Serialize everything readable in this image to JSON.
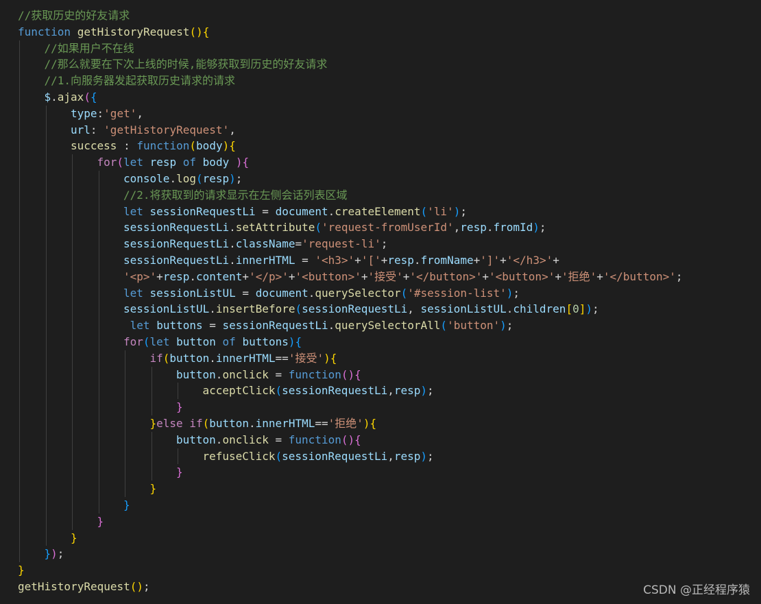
{
  "colors": {
    "background": "#1e1e1e",
    "comment": "#6a9955",
    "keyword": "#569cd6",
    "control": "#c586c0",
    "function": "#dcdcaa",
    "variable": "#9cdcfe",
    "string": "#ce9178",
    "number": "#b5cea8",
    "text": "#d4d4d4",
    "bracket1": "#ffd700",
    "bracket2": "#da70d6",
    "bracket3": "#179fff"
  },
  "editor": {
    "lines": [
      {
        "indent": 0,
        "tokens": [
          [
            "comment",
            "//获取历史的好友请求"
          ]
        ]
      },
      {
        "indent": 0,
        "tokens": [
          [
            "keyword",
            "function"
          ],
          [
            "text",
            " "
          ],
          [
            "function",
            "getHistoryRequest"
          ],
          [
            "bracket1",
            "(){"
          ]
        ]
      },
      {
        "indent": 1,
        "tokens": [
          [
            "comment",
            "//如果用户不在线"
          ]
        ]
      },
      {
        "indent": 1,
        "tokens": [
          [
            "comment",
            "//那么就要在下次上线的时候,能够获取到历史的好友请求"
          ]
        ]
      },
      {
        "indent": 1,
        "tokens": [
          [
            "comment",
            "//1.向服务器发起获取历史请求的请求"
          ]
        ]
      },
      {
        "indent": 1,
        "tokens": [
          [
            "variable",
            "$"
          ],
          [
            "text",
            "."
          ],
          [
            "function",
            "ajax"
          ],
          [
            "bracket2",
            "("
          ],
          [
            "bracket3",
            "{"
          ]
        ]
      },
      {
        "indent": 2,
        "tokens": [
          [
            "variable",
            "type"
          ],
          [
            "text",
            ":"
          ],
          [
            "string",
            "'get'"
          ],
          [
            "text",
            ","
          ]
        ]
      },
      {
        "indent": 2,
        "tokens": [
          [
            "variable",
            "url"
          ],
          [
            "text",
            ": "
          ],
          [
            "string",
            "'getHistoryRequest'"
          ],
          [
            "text",
            ","
          ]
        ]
      },
      {
        "indent": 2,
        "tokens": [
          [
            "function",
            "success"
          ],
          [
            "text",
            " : "
          ],
          [
            "keyword",
            "function"
          ],
          [
            "bracket1",
            "("
          ],
          [
            "variable",
            "body"
          ],
          [
            "bracket1",
            "){"
          ]
        ]
      },
      {
        "indent": 3,
        "tokens": [
          [
            "control",
            "for"
          ],
          [
            "bracket2",
            "("
          ],
          [
            "keyword",
            "let"
          ],
          [
            "text",
            " "
          ],
          [
            "variable",
            "resp"
          ],
          [
            "text",
            " "
          ],
          [
            "keyword",
            "of"
          ],
          [
            "text",
            " "
          ],
          [
            "variable",
            "body"
          ],
          [
            "text",
            " "
          ],
          [
            "bracket2",
            ")"
          ],
          [
            "bracket2",
            "{"
          ]
        ]
      },
      {
        "indent": 4,
        "tokens": [
          [
            "variable",
            "console"
          ],
          [
            "text",
            "."
          ],
          [
            "function",
            "log"
          ],
          [
            "bracket3",
            "("
          ],
          [
            "variable",
            "resp"
          ],
          [
            "bracket3",
            ")"
          ],
          [
            "text",
            ";"
          ]
        ]
      },
      {
        "indent": 4,
        "tokens": [
          [
            "comment",
            "//2.将获取到的请求显示在左侧会话列表区域"
          ]
        ]
      },
      {
        "indent": 4,
        "tokens": [
          [
            "keyword",
            "let"
          ],
          [
            "text",
            " "
          ],
          [
            "variable",
            "sessionRequestLi"
          ],
          [
            "text",
            " = "
          ],
          [
            "variable",
            "document"
          ],
          [
            "text",
            "."
          ],
          [
            "function",
            "createElement"
          ],
          [
            "bracket3",
            "("
          ],
          [
            "string",
            "'li'"
          ],
          [
            "bracket3",
            ")"
          ],
          [
            "text",
            ";"
          ]
        ]
      },
      {
        "indent": 4,
        "tokens": [
          [
            "variable",
            "sessionRequestLi"
          ],
          [
            "text",
            "."
          ],
          [
            "function",
            "setAttribute"
          ],
          [
            "bracket3",
            "("
          ],
          [
            "string",
            "'request-fromUserId'"
          ],
          [
            "text",
            ","
          ],
          [
            "variable",
            "resp"
          ],
          [
            "text",
            "."
          ],
          [
            "variable",
            "fromId"
          ],
          [
            "bracket3",
            ")"
          ],
          [
            "text",
            ";"
          ]
        ]
      },
      {
        "indent": 4,
        "tokens": [
          [
            "variable",
            "sessionRequestLi"
          ],
          [
            "text",
            "."
          ],
          [
            "variable",
            "className"
          ],
          [
            "text",
            "="
          ],
          [
            "string",
            "'request-li'"
          ],
          [
            "text",
            ";"
          ]
        ]
      },
      {
        "indent": 4,
        "tokens": [
          [
            "variable",
            "sessionRequestLi"
          ],
          [
            "text",
            "."
          ],
          [
            "variable",
            "innerHTML"
          ],
          [
            "text",
            " = "
          ],
          [
            "string",
            "'<h3>'"
          ],
          [
            "text",
            "+"
          ],
          [
            "string",
            "'['"
          ],
          [
            "text",
            "+"
          ],
          [
            "variable",
            "resp"
          ],
          [
            "text",
            "."
          ],
          [
            "variable",
            "fromName"
          ],
          [
            "text",
            "+"
          ],
          [
            "string",
            "']'"
          ],
          [
            "text",
            "+"
          ],
          [
            "string",
            "'</h3>'"
          ],
          [
            "text",
            "+"
          ]
        ]
      },
      {
        "indent": 4,
        "tokens": [
          [
            "string",
            "'<p>'"
          ],
          [
            "text",
            "+"
          ],
          [
            "variable",
            "resp"
          ],
          [
            "text",
            "."
          ],
          [
            "variable",
            "content"
          ],
          [
            "text",
            "+"
          ],
          [
            "string",
            "'</p>'"
          ],
          [
            "text",
            "+"
          ],
          [
            "string",
            "'<button>'"
          ],
          [
            "text",
            "+"
          ],
          [
            "string",
            "'接受'"
          ],
          [
            "text",
            "+"
          ],
          [
            "string",
            "'</button>'"
          ],
          [
            "text",
            "+"
          ],
          [
            "string",
            "'<button>'"
          ],
          [
            "text",
            "+"
          ],
          [
            "string",
            "'拒绝'"
          ],
          [
            "text",
            "+"
          ],
          [
            "string",
            "'</button>'"
          ],
          [
            "text",
            ";"
          ]
        ]
      },
      {
        "indent": 4,
        "tokens": [
          [
            "keyword",
            "let"
          ],
          [
            "text",
            " "
          ],
          [
            "variable",
            "sessionListUL"
          ],
          [
            "text",
            " = "
          ],
          [
            "variable",
            "document"
          ],
          [
            "text",
            "."
          ],
          [
            "function",
            "querySelector"
          ],
          [
            "bracket3",
            "("
          ],
          [
            "string",
            "'#session-list'"
          ],
          [
            "bracket3",
            ")"
          ],
          [
            "text",
            ";"
          ]
        ]
      },
      {
        "indent": 4,
        "tokens": [
          [
            "variable",
            "sessionListUL"
          ],
          [
            "text",
            "."
          ],
          [
            "function",
            "insertBefore"
          ],
          [
            "bracket3",
            "("
          ],
          [
            "variable",
            "sessionRequestLi"
          ],
          [
            "text",
            ", "
          ],
          [
            "variable",
            "sessionListUL"
          ],
          [
            "text",
            "."
          ],
          [
            "variable",
            "children"
          ],
          [
            "bracket1",
            "["
          ],
          [
            "number",
            "0"
          ],
          [
            "bracket1",
            "]"
          ],
          [
            "bracket3",
            ")"
          ],
          [
            "text",
            ";"
          ]
        ]
      },
      {
        "indent": 4,
        "tokens": [
          [
            "text",
            " "
          ],
          [
            "keyword",
            "let"
          ],
          [
            "text",
            " "
          ],
          [
            "variable",
            "buttons"
          ],
          [
            "text",
            " = "
          ],
          [
            "variable",
            "sessionRequestLi"
          ],
          [
            "text",
            "."
          ],
          [
            "function",
            "querySelectorAll"
          ],
          [
            "bracket3",
            "("
          ],
          [
            "string",
            "'button'"
          ],
          [
            "bracket3",
            ")"
          ],
          [
            "text",
            ";"
          ]
        ]
      },
      {
        "indent": 4,
        "tokens": [
          [
            "control",
            "for"
          ],
          [
            "bracket3",
            "("
          ],
          [
            "keyword",
            "let"
          ],
          [
            "text",
            " "
          ],
          [
            "variable",
            "button"
          ],
          [
            "text",
            " "
          ],
          [
            "keyword",
            "of"
          ],
          [
            "text",
            " "
          ],
          [
            "variable",
            "buttons"
          ],
          [
            "bracket3",
            ")"
          ],
          [
            "bracket3",
            "{"
          ]
        ]
      },
      {
        "indent": 5,
        "tokens": [
          [
            "control",
            "if"
          ],
          [
            "bracket1",
            "("
          ],
          [
            "variable",
            "button"
          ],
          [
            "text",
            "."
          ],
          [
            "variable",
            "innerHTML"
          ],
          [
            "text",
            "=="
          ],
          [
            "string",
            "'接受'"
          ],
          [
            "bracket1",
            ")"
          ],
          [
            "bracket1",
            "{"
          ]
        ]
      },
      {
        "indent": 6,
        "tokens": [
          [
            "variable",
            "button"
          ],
          [
            "text",
            "."
          ],
          [
            "function",
            "onclick"
          ],
          [
            "text",
            " = "
          ],
          [
            "keyword",
            "function"
          ],
          [
            "bracket2",
            "(){"
          ]
        ]
      },
      {
        "indent": 7,
        "tokens": [
          [
            "function",
            "acceptClick"
          ],
          [
            "bracket3",
            "("
          ],
          [
            "variable",
            "sessionRequestLi"
          ],
          [
            "text",
            ","
          ],
          [
            "variable",
            "resp"
          ],
          [
            "bracket3",
            ")"
          ],
          [
            "text",
            ";"
          ]
        ]
      },
      {
        "indent": 6,
        "tokens": [
          [
            "bracket2",
            "}"
          ]
        ]
      },
      {
        "indent": 5,
        "tokens": [
          [
            "bracket1",
            "}"
          ],
          [
            "control",
            "else"
          ],
          [
            "text",
            " "
          ],
          [
            "control",
            "if"
          ],
          [
            "bracket1",
            "("
          ],
          [
            "variable",
            "button"
          ],
          [
            "text",
            "."
          ],
          [
            "variable",
            "innerHTML"
          ],
          [
            "text",
            "=="
          ],
          [
            "string",
            "'拒绝'"
          ],
          [
            "bracket1",
            ")"
          ],
          [
            "bracket1",
            "{"
          ]
        ]
      },
      {
        "indent": 6,
        "tokens": [
          [
            "variable",
            "button"
          ],
          [
            "text",
            "."
          ],
          [
            "function",
            "onclick"
          ],
          [
            "text",
            " = "
          ],
          [
            "keyword",
            "function"
          ],
          [
            "bracket2",
            "(){"
          ]
        ]
      },
      {
        "indent": 7,
        "tokens": [
          [
            "function",
            "refuseClick"
          ],
          [
            "bracket3",
            "("
          ],
          [
            "variable",
            "sessionRequestLi"
          ],
          [
            "text",
            ","
          ],
          [
            "variable",
            "resp"
          ],
          [
            "bracket3",
            ")"
          ],
          [
            "text",
            ";"
          ]
        ]
      },
      {
        "indent": 6,
        "tokens": [
          [
            "bracket2",
            "}"
          ]
        ]
      },
      {
        "indent": 5,
        "tokens": [
          [
            "bracket1",
            "}"
          ]
        ]
      },
      {
        "indent": 4,
        "tokens": [
          [
            "bracket3",
            "}"
          ]
        ]
      },
      {
        "indent": 3,
        "tokens": [
          [
            "bracket2",
            "}"
          ]
        ]
      },
      {
        "indent": 2,
        "tokens": [
          [
            "bracket1",
            "}"
          ]
        ]
      },
      {
        "indent": 1,
        "tokens": [
          [
            "bracket3",
            "}"
          ],
          [
            "bracket2",
            ")"
          ],
          [
            "text",
            ";"
          ]
        ]
      },
      {
        "indent": 0,
        "tokens": [
          [
            "bracket1",
            "}"
          ]
        ]
      },
      {
        "indent": 0,
        "tokens": [
          [
            "function",
            "getHistoryRequest"
          ],
          [
            "bracket1",
            "()"
          ],
          [
            "text",
            ";"
          ]
        ]
      }
    ]
  },
  "watermark": "CSDN @正经程序猿"
}
